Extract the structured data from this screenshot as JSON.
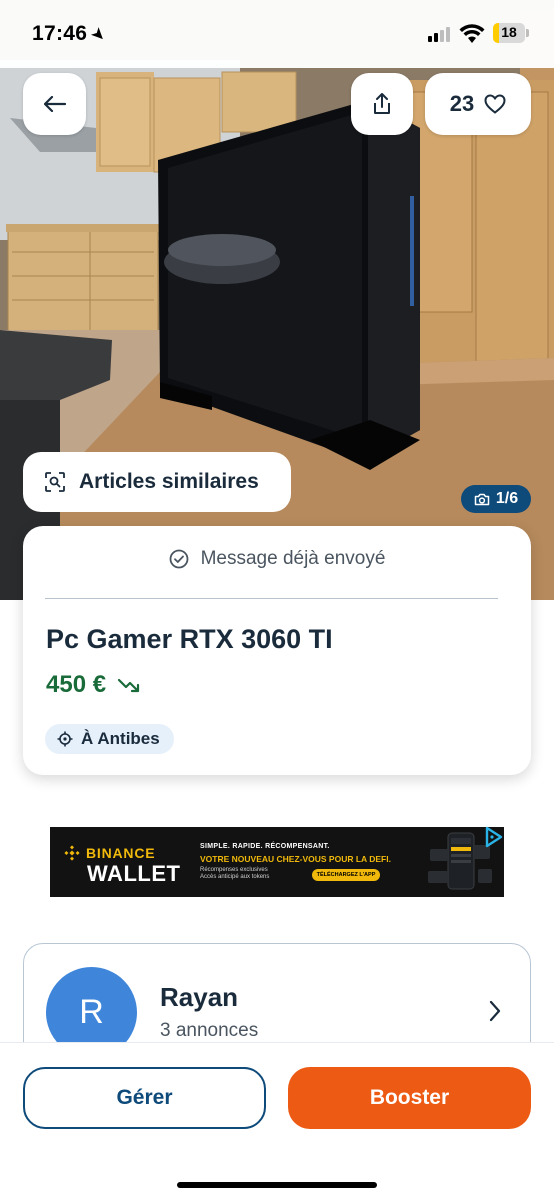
{
  "status_bar": {
    "time": "17:46",
    "battery": "18",
    "battery_level": 0.18,
    "icons": [
      "location-arrow-icon",
      "cellular-signal-icon",
      "wifi-icon",
      "battery-icon"
    ]
  },
  "photo": {
    "description_icon": "pc-case-photo",
    "counter": "1/6",
    "similar_label": "Articles similaires"
  },
  "top_actions": {
    "back_icon": "arrow-left-icon",
    "share_icon": "share-icon",
    "favorites_count": "23",
    "favorite_icon": "heart-outline-icon"
  },
  "listing": {
    "message_status": "Message déjà envoyé",
    "title": "Pc Gamer RTX 3060 TI",
    "price": "450 €",
    "location": "À Antibes"
  },
  "ad": {
    "brand_top": "BINANCE",
    "brand_bottom": "WALLET",
    "tagline": "SIMPLE. RAPIDE. RÉCOMPENSANT.",
    "headline": "VOTRE NOUVEAU CHEZ-VOUS POUR LA DEFI.",
    "sub1": "Récompenses exclusives",
    "sub2": "Accès anticipé aux tokens",
    "cta": "TÉLÉCHARGEZ L'APP"
  },
  "seller": {
    "initial": "R",
    "name": "Rayan",
    "listings": "3 annonces"
  },
  "actions": {
    "manage": "Gérer",
    "boost": "Booster"
  },
  "colors": {
    "brand_blue": "#0e4a7a",
    "price_green": "#1a6b3a",
    "boost_orange": "#ec5a13",
    "avatar_blue": "#3f86db",
    "chip_bg": "#e6f0fb",
    "binance_yellow": "#f0b90b"
  }
}
